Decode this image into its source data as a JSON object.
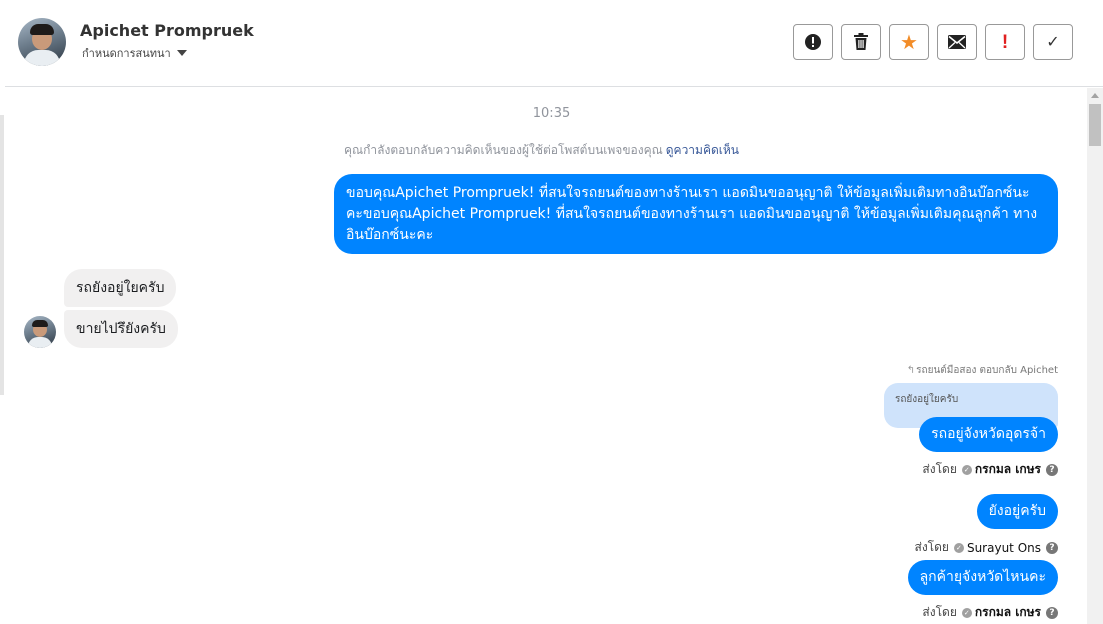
{
  "header": {
    "name": "Apichet Prompruek",
    "assign_label": "กำหนดการสนทนา",
    "toolbar": [
      {
        "icon": "alert-circle-icon"
      },
      {
        "icon": "trash-icon"
      },
      {
        "icon": "star-icon",
        "symbol": "★",
        "color": "#f28c28"
      },
      {
        "icon": "envelope-icon"
      },
      {
        "icon": "important-icon",
        "symbol": "!",
        "color": "#e02020"
      },
      {
        "icon": "check-icon",
        "symbol": "✓"
      }
    ]
  },
  "conversation": {
    "timestamp": "10:35",
    "notice": {
      "text": "คุณกำลังตอบกลับความคิดเห็นของผู้ใช้ต่อโพสต์บนเพจของคุณ",
      "link": "ดูความคิดเห็น"
    },
    "messages": {
      "page_reply_1": "ขอบคุณApichet Prompruek! ที่สนใจรถยนต์ของทางร้านเรา แอดมินขออนุญาติ ให้ข้อมูลเพิ่มเติมทางอินบ๊อกซ์นะคะขอบคุณApichet Prompruek! ที่สนใจรถยนต์ของทางร้านเรา แอดมินขออนุญาติ ให้ข้อมูลเพิ่มเติมคุณลูกค้า ทางอินบ๊อกซ์นะคะ",
      "customer_1": "รถยังอยู่ใยครับ",
      "customer_2": "ขายไปรึยังครับ",
      "reply_meta": "รถยนต์มือสอง ตอบกลับ Apichet",
      "quoted": "รถยังอยู่ใยครับ",
      "page_reply_2": "รถอยู่จังหวัดอุดรจ้า",
      "sent_by_1": {
        "prefix": "ส่งโดย",
        "name": "กรกมล เกษร"
      },
      "page_reply_3": "ยังอยู่ครับ",
      "sent_by_2": {
        "prefix": "ส่งโดย",
        "name": "Surayut Ons"
      },
      "page_reply_4": "ลูกค้ายุจังหวัดไหนคะ",
      "sent_by_3": {
        "prefix": "ส่งโดย",
        "name": "กรกมล เกษร"
      }
    }
  },
  "colors": {
    "outgoing_bubble": "#0084ff",
    "incoming_bubble": "#f1f0f0",
    "quote_bubble": "#cfe3fb",
    "link": "#385898"
  }
}
